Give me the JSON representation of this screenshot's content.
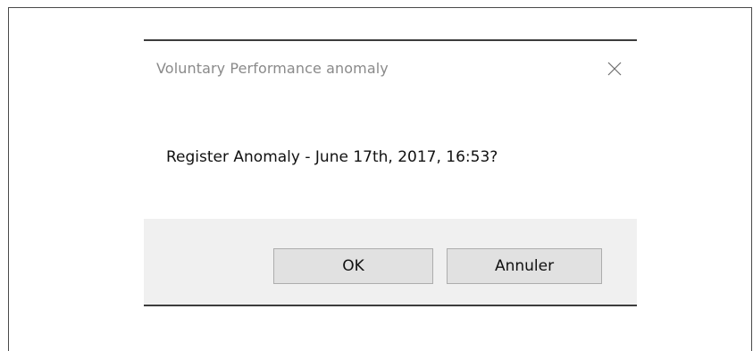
{
  "dialog": {
    "title": "Voluntary Performance anomaly",
    "message": "Register Anomaly - June 17th, 2017, 16:53?",
    "buttons": {
      "ok_label": "OK",
      "cancel_label": "Annuler"
    },
    "icons": {
      "close": "close-icon"
    }
  }
}
